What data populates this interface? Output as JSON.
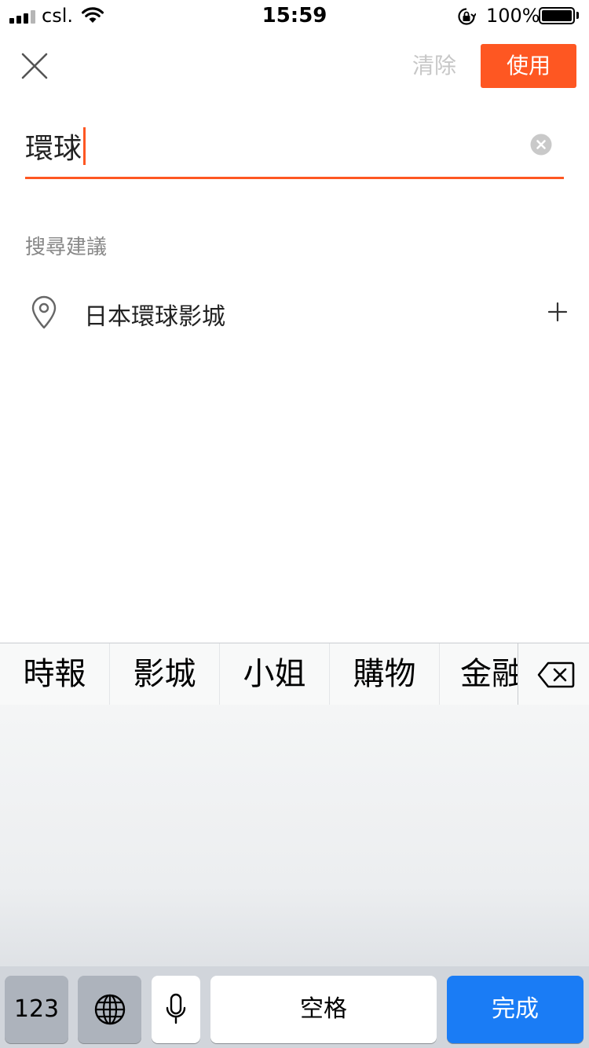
{
  "status_bar": {
    "carrier": "csl.",
    "time": "15:59",
    "battery_percent": "100%",
    "signal_bars": 4,
    "battery_level": 1.0
  },
  "header": {
    "close_icon": "close-icon",
    "clear_label": "清除",
    "use_label": "使用"
  },
  "search": {
    "value": "環球",
    "clear_icon": "clear-circle-icon"
  },
  "suggestions": {
    "section_title": "搜尋建議",
    "items": [
      {
        "label": "日本環球影城",
        "icon": "location-pin-icon",
        "action_icon": "plus-icon"
      }
    ]
  },
  "keyboard": {
    "candidates": [
      "時報",
      "影城",
      "小姐",
      "購物",
      "金融"
    ],
    "key_123": "123",
    "key_space": "空格",
    "key_done": "完成"
  },
  "colors": {
    "accent": "#fe5722",
    "done_key": "#1a7cf5"
  }
}
